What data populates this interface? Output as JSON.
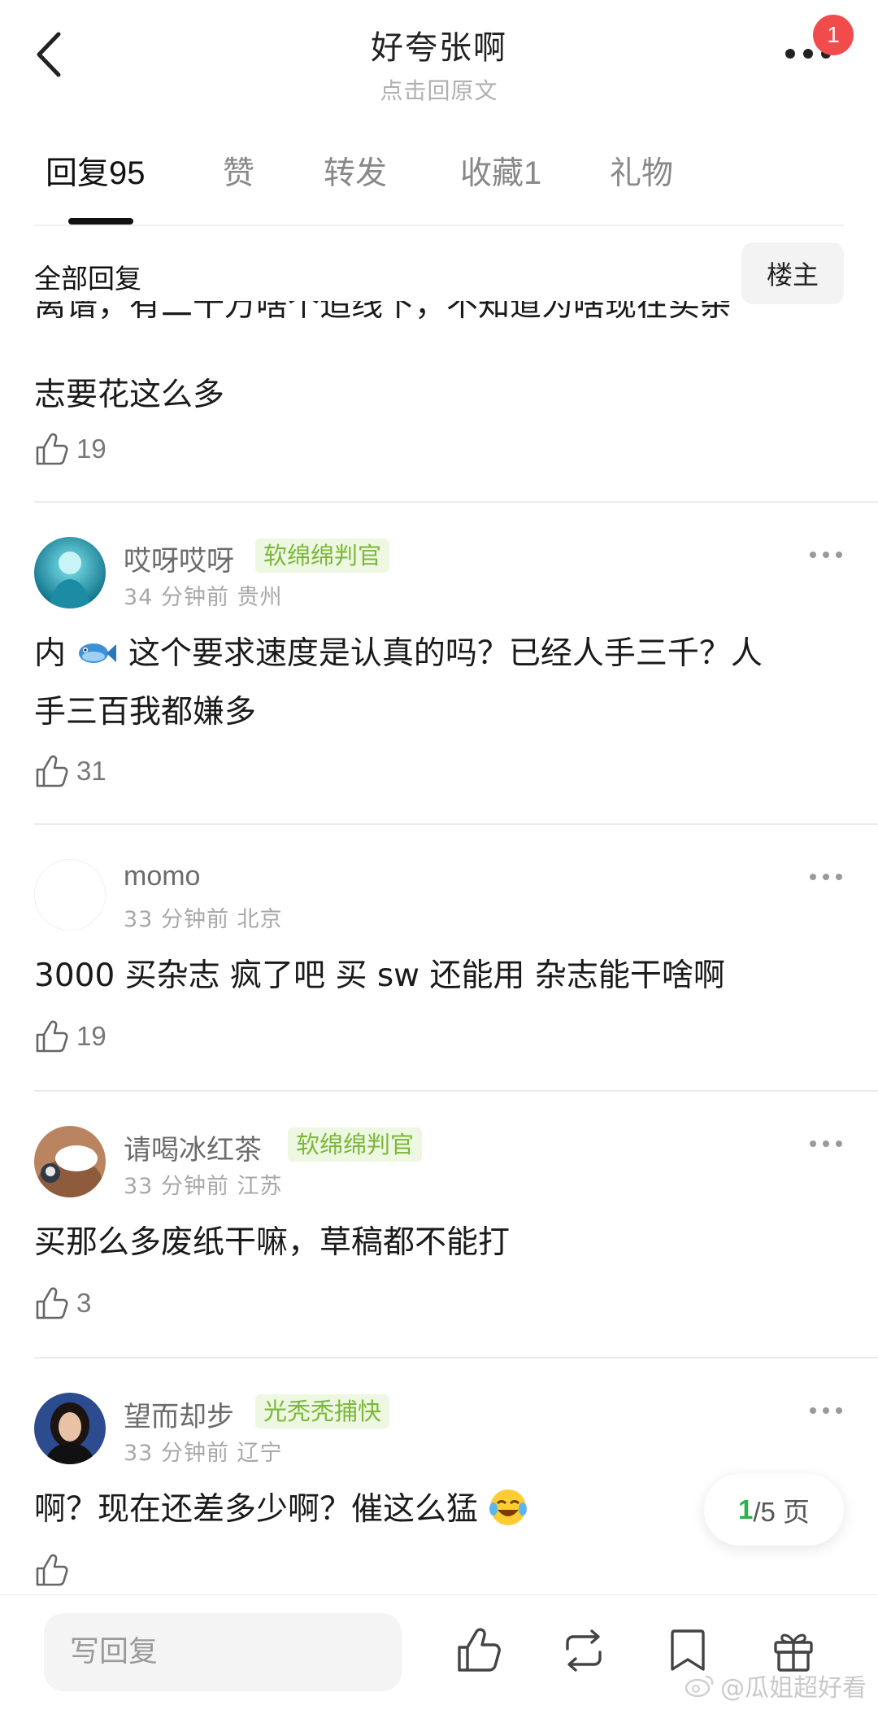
{
  "header": {
    "title": "好夸张啊",
    "subtitle": "点击回原文",
    "badge_count": "1"
  },
  "tabs": [
    {
      "label": "回复",
      "count": "95",
      "active": true
    },
    {
      "label": "赞",
      "count": ""
    },
    {
      "label": "转发",
      "count": ""
    },
    {
      "label": "收藏",
      "count": "1"
    },
    {
      "label": "礼物",
      "count": ""
    }
  ],
  "section": {
    "title": "全部回复",
    "filter_label": "楼主"
  },
  "partial_comment": {
    "line1": "离谱，有二十万啥个追线下，不知道为啥现在买杂",
    "line2": "志要花这么多",
    "likes": "19"
  },
  "comments": [
    {
      "username": "哎呀哎呀",
      "badge": "软绵绵判官",
      "time": "34 分钟前",
      "location": "贵州",
      "text_a": "内",
      "text_b": "这个要求速度是认真的吗？已经人手三千？人",
      "text_c": "手三百我都嫌多",
      "likes": "31"
    },
    {
      "username": "momo",
      "badge": "",
      "time": "33 分钟前",
      "location": "北京",
      "text_a": "3000 买杂志 疯了吧 买 sw 还能用 杂志能干啥啊",
      "likes": "19"
    },
    {
      "username": "请喝冰红茶",
      "badge": "软绵绵判官",
      "time": "33 分钟前",
      "location": "江苏",
      "text_a": "买那么多废纸干嘛，草稿都不能打",
      "likes": "3"
    },
    {
      "username": "望而却步",
      "badge": "光秃秃捕快",
      "time": "33 分钟前",
      "location": "辽宁",
      "text_a": "啊？现在还差多少啊？催这么猛",
      "likes": ""
    }
  ],
  "pagination": {
    "current": "1",
    "total_text": "/5 页"
  },
  "bottom_bar": {
    "reply_placeholder": "写回复"
  },
  "watermark": "@瓜姐超好看",
  "colors": {
    "accent_green": "#2bb34a",
    "badge_red": "#f24b4b",
    "tag_green": "#7bb83a"
  }
}
